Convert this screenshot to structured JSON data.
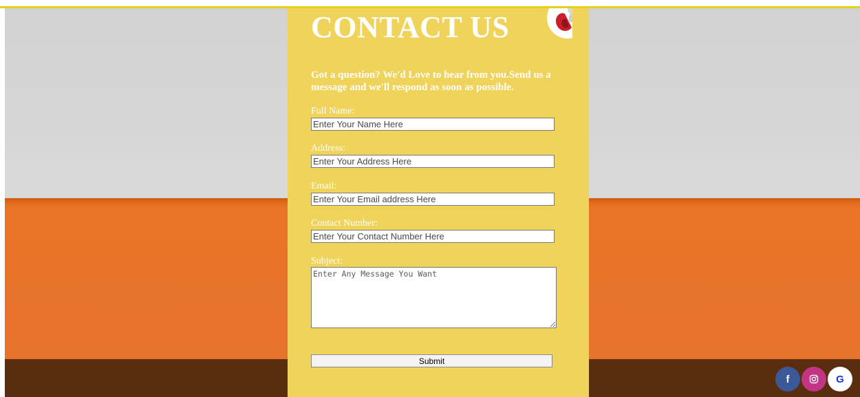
{
  "header": {
    "title": "CONTACT US",
    "intro": "Got a question? We'd Love to hear from you.Send us a message and we'll respond as soon as possible."
  },
  "form": {
    "full_name": {
      "label": "Full Name:",
      "placeholder": "Enter Your Name Here",
      "value": ""
    },
    "address": {
      "label": "Address:",
      "placeholder": "Enter Your Address Here",
      "value": ""
    },
    "email": {
      "label": "Email:",
      "placeholder": "Enter Your Email address Here",
      "value": ""
    },
    "contact_number": {
      "label": "Contact Number:",
      "placeholder": "Enter Your Contact Number Here",
      "value": ""
    },
    "subject": {
      "label": "Subject:",
      "placeholder": "Enter Any Message You Want",
      "value": ""
    },
    "submit_label": "Submit"
  },
  "social": [
    {
      "icon": "facebook-icon",
      "glyph": "f",
      "color": "#3b5998"
    },
    {
      "icon": "instagram-icon",
      "glyph": "",
      "color": "#c13584"
    },
    {
      "icon": "google-icon",
      "glyph": "G",
      "color": "#ffffff"
    }
  ],
  "colors": {
    "panel": "#efd35a",
    "accent_line": "#e8cf18",
    "wall": "#d4d4d4",
    "orange": "#e8732a",
    "floor": "#5a2d0e"
  }
}
